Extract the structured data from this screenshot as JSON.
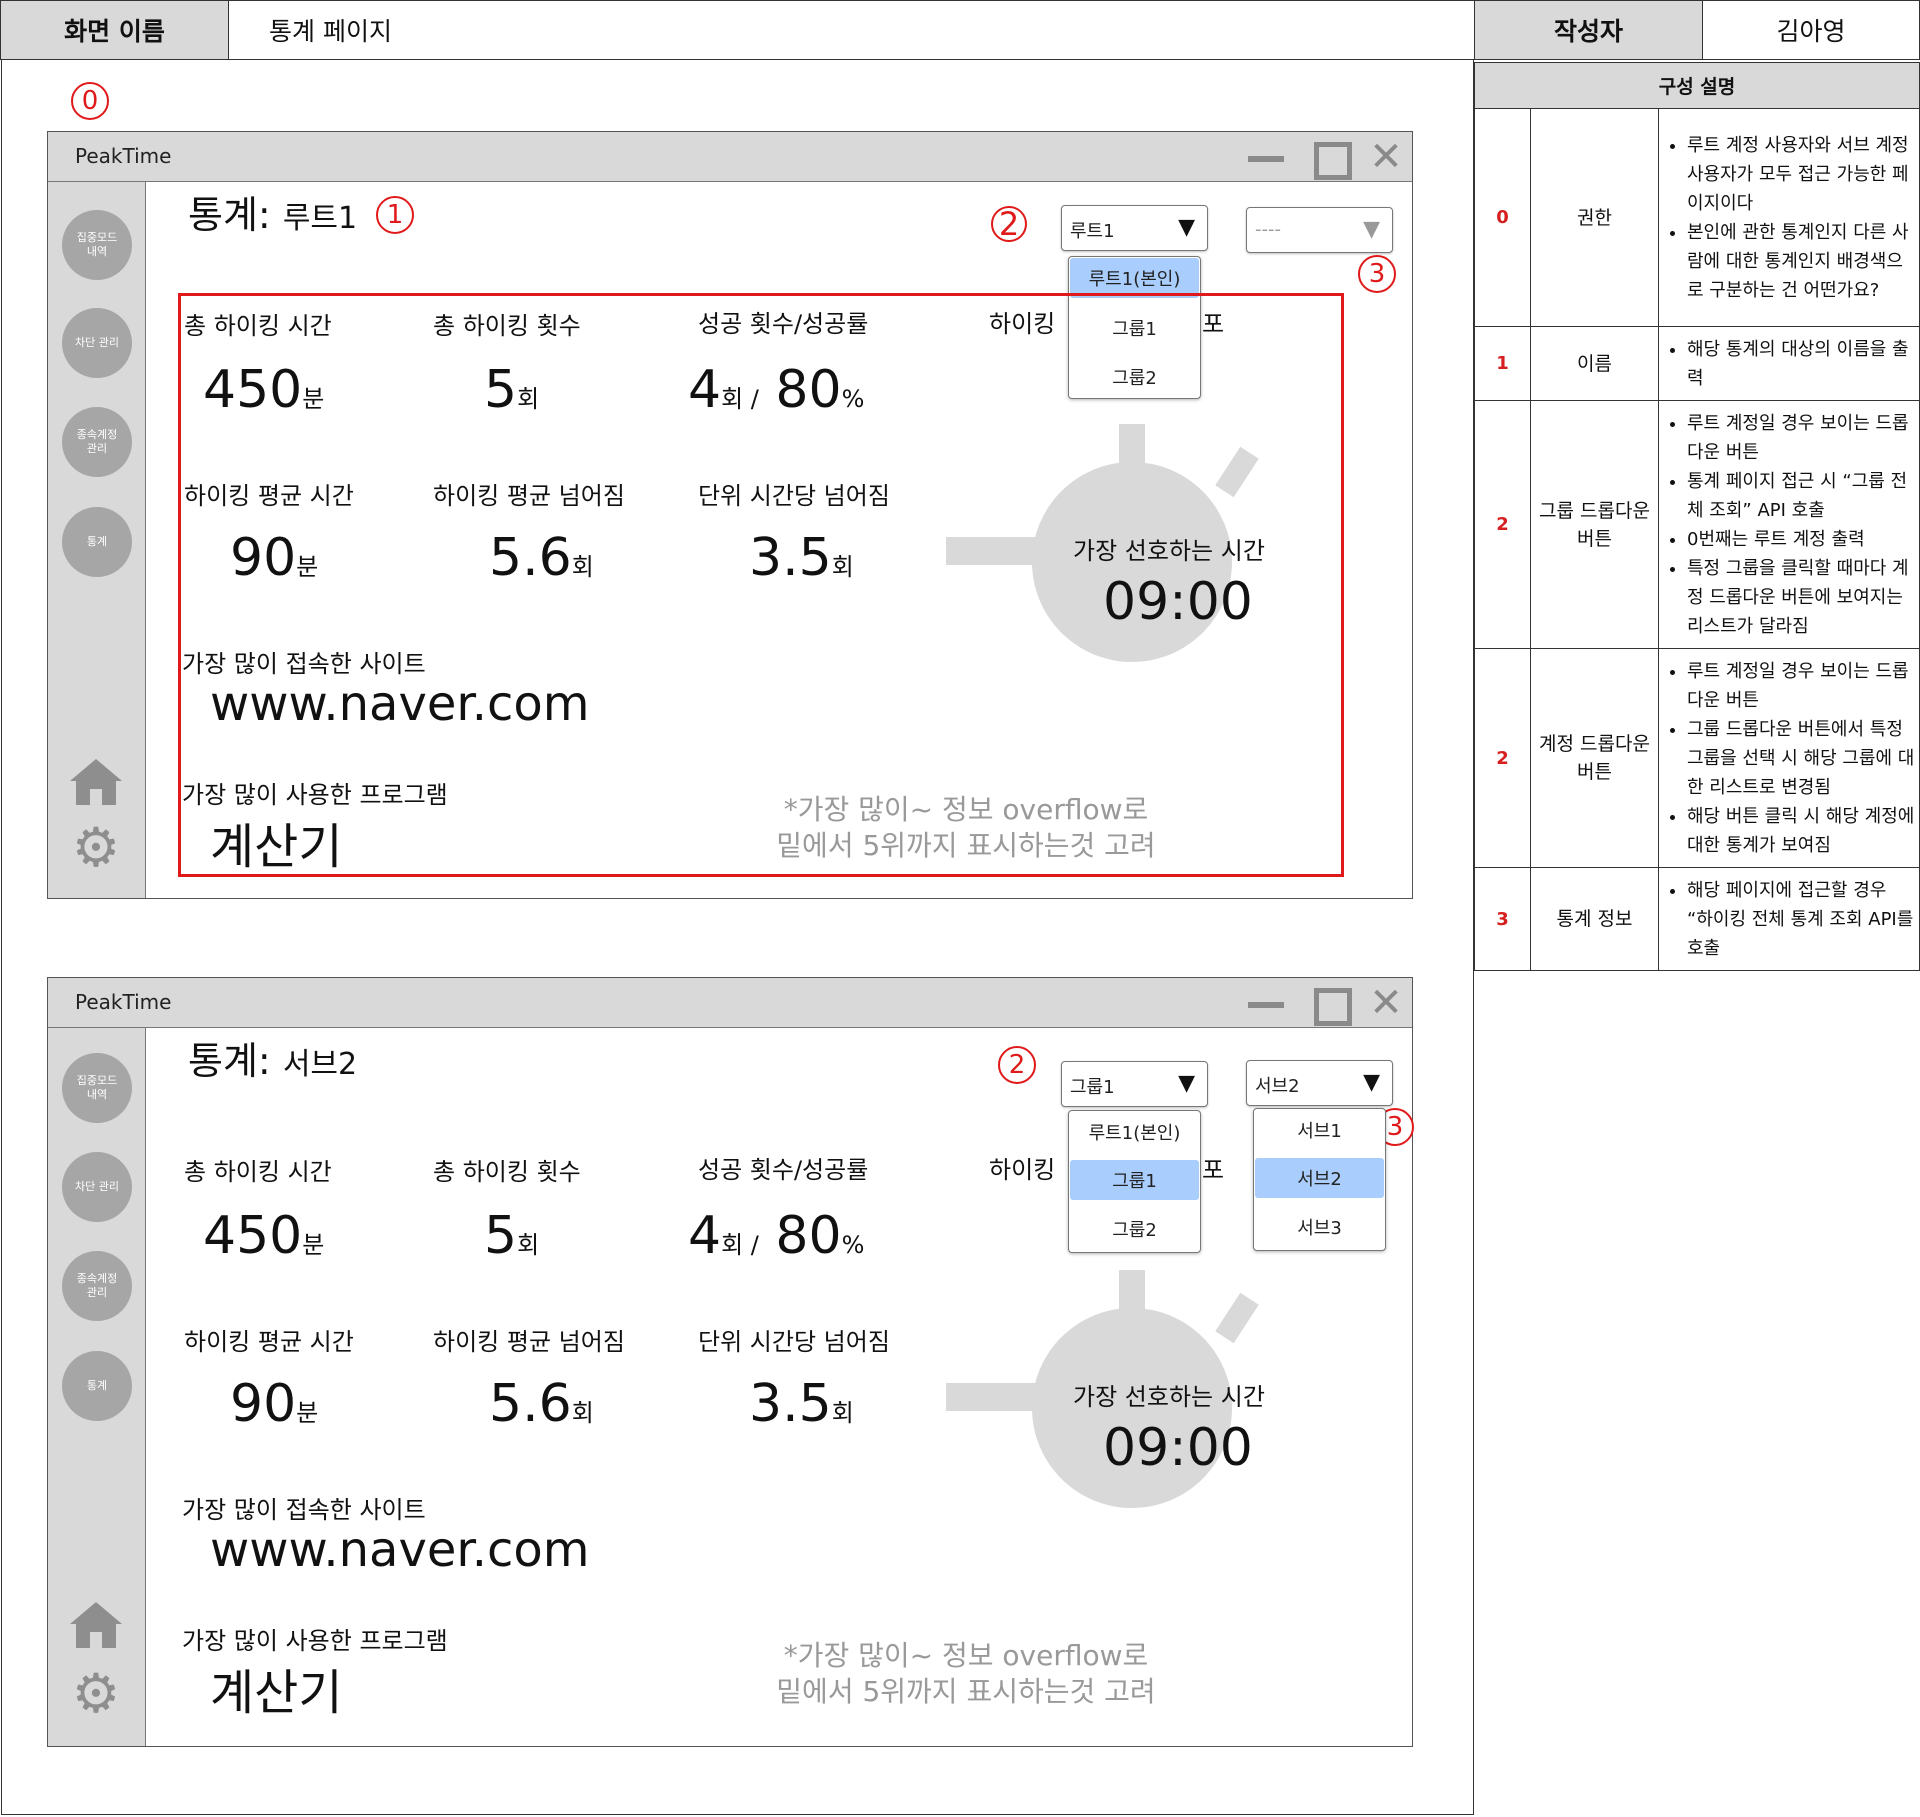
{
  "header": {
    "screen_name_label": "화면 이름",
    "screen_name_value": "통계 페이지",
    "author_label": "작성자",
    "author_value": "김아영"
  },
  "annotations": {
    "m0": "0",
    "m1": "1",
    "m2": "2",
    "m3": "3"
  },
  "app": {
    "title": "PeakTime",
    "close_glyph": "✕",
    "sidebar_items": [
      "집중모드 내역",
      "차단 관리",
      "종속계정 관리",
      "통계"
    ],
    "title_prefix": "통계:"
  },
  "stats": {
    "total_time_label": "총 하이킹 시간",
    "total_time_value": "450",
    "total_time_unit": "분",
    "total_count_label": "총 하이킹 횟수",
    "total_count_value": "5",
    "total_count_unit": "회",
    "success_label": "성공 횟수/성공률",
    "success_count": "4",
    "success_count_unit": "회 /",
    "success_rate": "80",
    "success_rate_unit": "%",
    "avg_time_label": "하이킹 평균 시간",
    "avg_time_value": "90",
    "avg_time_unit": "분",
    "avg_fall_label": "하이킹 평균 넘어짐",
    "avg_fall_value": "5.6",
    "avg_fall_unit": "회",
    "unit_fall_label": "단위 시간당 넘어짐",
    "unit_fall_value": "3.5",
    "unit_fall_unit": "회",
    "hiking_dist_label_start": "하이킹",
    "hiking_dist_label_end": "포",
    "preferred_time_label": "가장 선호하는 시간",
    "preferred_time_value": "09:00",
    "top_site_label": "가장 많이 접속한 사이트",
    "top_site_value": "www.naver.com",
    "top_program_label": "가장 많이 사용한 프로그램",
    "top_program_value": "계산기",
    "note_line1": "*가장 많이~ 정보 overflow로",
    "note_line2": "밑에서 5위까지 표시하는것 고려"
  },
  "window1": {
    "target_name": "루트1",
    "group_dropdown_value": "루트1",
    "account_dropdown_value": "----",
    "group_menu": [
      "루트1(본인)",
      "그룹1",
      "그룹2"
    ],
    "group_menu_selected": "루트1(본인)"
  },
  "window2": {
    "target_name": "서브2",
    "group_dropdown_value": "그룹1",
    "account_dropdown_value": "서브2",
    "group_menu": [
      "루트1(본인)",
      "그룹1",
      "그룹2"
    ],
    "group_menu_selected": "그룹1",
    "account_menu": [
      "서브1",
      "서브2",
      "서브3"
    ],
    "account_menu_selected": "서브2"
  },
  "description": {
    "title": "구성 설명",
    "rows": [
      {
        "num": "0",
        "section": "권한",
        "bullets": [
          "루트 계정 사용자와 서브 계정 사용자가 모두 접근 가능한 페이지이다",
          "본인에 관한 통계인지 다른 사람에 대한 통계인지 배경색으로 구분하는 건 어떤가요?"
        ]
      },
      {
        "num": "1",
        "section": "이름",
        "bullets": [
          "해당 통계의 대상의 이름을 출력"
        ]
      },
      {
        "num": "2",
        "section": "그룹 드롭다운 버튼",
        "bullets": [
          "루트 계정일 경우 보이는 드롭다운 버튼",
          "통계 페이지 접근 시 “그룹 전체 조회” API 호출",
          "0번째는 루트 계정 출력",
          "특정 그룹을 클릭할 때마다 계정 드롭다운 버튼에 보여지는 리스트가 달라짐"
        ]
      },
      {
        "num": "2",
        "section": "계정 드롭다운 버튼",
        "bullets": [
          "루트 계정일 경우 보이는 드롭다운 버튼",
          "그룹 드롭다운 버튼에서 특정 그룹을 선택 시 해당 그룹에 대한 리스트로 변경됨",
          "해당 버튼 클릭 시 해당 계정에 대한 통계가 보여짐"
        ]
      },
      {
        "num": "3",
        "section": "통계 정보",
        "bullets": [
          "해당 페이지에 접근할 경우 “하이킹 전체 통계 조회 API를 호출"
        ]
      }
    ]
  },
  "colors": {
    "annotation_red": "#e01a1a",
    "selected_blue": "#a9cdfd",
    "sidebar_gray": "#d9d9d9",
    "nav_circle_gray": "#a6a6a6",
    "stopwatch_gray": "#d9d9d9"
  },
  "icons": [
    "minimize-icon",
    "maximize-icon",
    "close-icon",
    "dropdown-arrow-icon",
    "home-icon",
    "gear-icon",
    "stopwatch-icon"
  ]
}
